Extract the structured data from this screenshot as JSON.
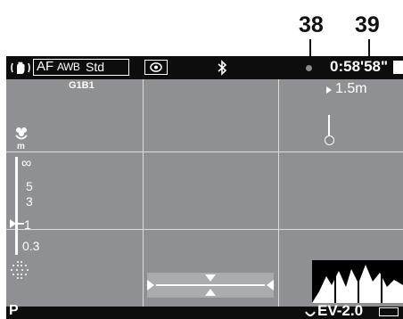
{
  "callouts": {
    "left": "38",
    "right": "39"
  },
  "top_bar": {
    "af_label": "AF",
    "wb_label": "AWB",
    "style_label": "Std",
    "time_display": "0:58'58\"",
    "icons": [
      "shake-reduction-icon",
      "metering-icon",
      "bluetooth-icon"
    ]
  },
  "sub_row": {
    "wb_fine_tune": "G1B1",
    "subject_distance": "1.5m"
  },
  "distance_scale": {
    "marks": [
      "∞",
      "5",
      "3",
      "1",
      "0.3"
    ],
    "unit": "m",
    "indicator_value": "1"
  },
  "bottom_bar": {
    "mode": "P",
    "exposure_compensation": "EV-2.0"
  },
  "colors": {
    "screen_bg": "#8e9093",
    "bar_bg": "#0d0d0d",
    "text": "#ffffff"
  }
}
